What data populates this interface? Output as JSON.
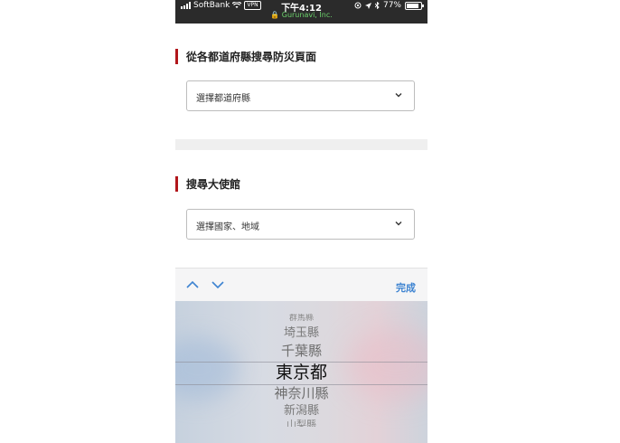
{
  "status_bar": {
    "carrier": "SoftBank",
    "vpn": "VPN",
    "time": "下午4:12",
    "site": "Gurunavi, Inc.",
    "battery": "77%",
    "battery_level": 0.77
  },
  "disaster_section": {
    "title": "從各都道府縣搜尋防災頁面",
    "select_value": "選擇都道府縣"
  },
  "embassy_section": {
    "title": "搜尋大使館",
    "select_value": "選擇國家、地域"
  },
  "picker_toolbar": {
    "done_label": "完成"
  },
  "picker": {
    "options": [
      "群馬縣",
      "埼玉縣",
      "千葉縣",
      "東京都",
      "神奈川縣",
      "新潟縣",
      "山梨縣"
    ],
    "selected": "東京都"
  },
  "colors": {
    "accent_red": "#b1161b",
    "link_blue": "#3d83d1",
    "status_bar_bg": "#2b2b2b"
  }
}
